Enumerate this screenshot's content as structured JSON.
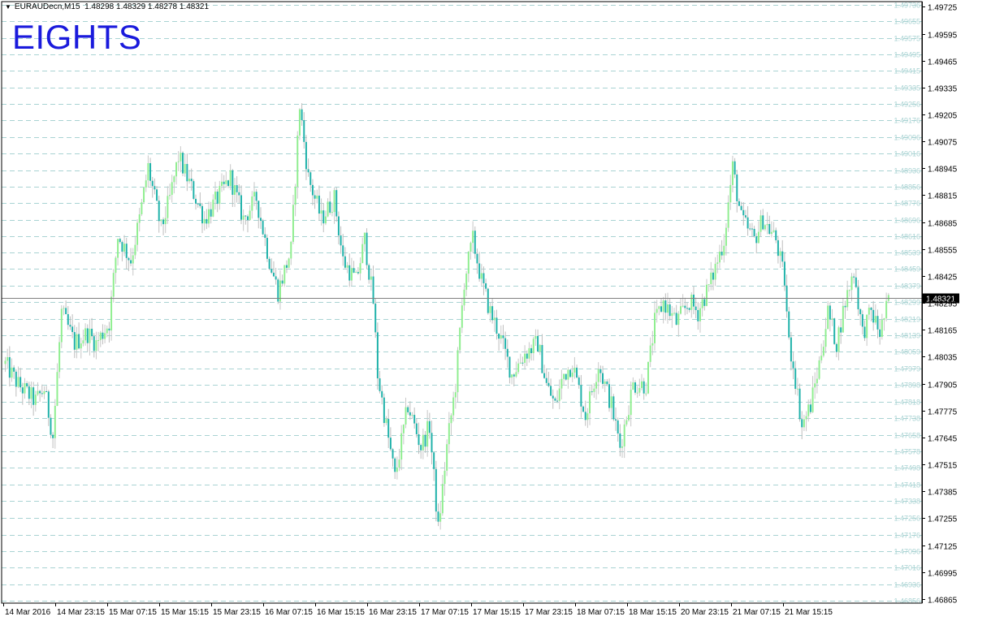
{
  "header": {
    "symbol_period": "EURAUDecn,M15",
    "ohlc": "1.48298 1.48329 1.48278 1.48321"
  },
  "watermark": "EIGHTS",
  "colors": {
    "bull": "#90ee90",
    "bear": "#20b2aa",
    "wick_bull": "#c8c8c8",
    "wick_bear": "#bdbdbd",
    "level": "#a9d3d3",
    "grid": "#d6e6e6",
    "axis": "#000000",
    "price_line": "#808080",
    "price_tag": "#000000"
  },
  "chart_data": {
    "type": "candlestick",
    "title": "",
    "symbol": "EURAUDecn",
    "timeframe": "M15",
    "current_price": "1.48321",
    "ylim": [
      1.46805,
      1.48905
    ],
    "y_ticks": [
      "1.49725",
      "1.49595",
      "1.49465",
      "1.49335",
      "1.49205",
      "1.49075",
      "1.48945",
      "1.48815",
      "1.48685",
      "1.48555",
      "1.48425",
      "1.48295",
      "1.48165",
      "1.48035",
      "1.47905",
      "1.47775",
      "1.47645",
      "1.47515",
      "1.47385",
      "1.47255",
      "1.47125",
      "1.46995",
      "1.46865"
    ],
    "levels": [
      "1.49736",
      "1.49655",
      "1.49575",
      "1.49495",
      "1.49415",
      "1.49335",
      "1.49256",
      "1.49176",
      "1.49096",
      "1.49016",
      "1.48936",
      "1.48856",
      "1.48776",
      "1.48696",
      "1.48616",
      "1.48539",
      "1.48459",
      "1.48379",
      "1.48299",
      "1.48219",
      "1.48139",
      "1.48059",
      "1.47979",
      "1.47898",
      "1.47818",
      "1.47738",
      "1.47658",
      "1.47578",
      "1.47498",
      "1.47418",
      "1.47338",
      "1.47256",
      "1.47176",
      "1.47096",
      "1.47016",
      "1.46936",
      "1.46856"
    ],
    "x_labels": [
      "14 Mar 2016",
      "14 Mar 23:15",
      "15 Mar 07:15",
      "15 Mar 15:15",
      "15 Mar 23:15",
      "16 Mar 07:15",
      "16 Mar 15:15",
      "16 Mar 23:15",
      "17 Mar 07:15",
      "17 Mar 15:15",
      "17 Mar 23:15",
      "18 Mar 07:15",
      "18 Mar 15:15",
      "20 Mar 23:15",
      "21 Mar 07:15",
      "21 Mar 15:15"
    ],
    "waypoints": [
      [
        0,
        1.48
      ],
      [
        6,
        1.479
      ],
      [
        14,
        1.4782
      ],
      [
        18,
        1.4788
      ],
      [
        22,
        1.4765
      ],
      [
        26,
        1.4825
      ],
      [
        32,
        1.481
      ],
      [
        38,
        1.4815
      ],
      [
        42,
        1.481
      ],
      [
        48,
        1.482
      ],
      [
        52,
        1.4862
      ],
      [
        58,
        1.485
      ],
      [
        62,
        1.487
      ],
      [
        66,
        1.4895
      ],
      [
        72,
        1.4865
      ],
      [
        76,
        1.488
      ],
      [
        80,
        1.49
      ],
      [
        86,
        1.4885
      ],
      [
        92,
        1.487
      ],
      [
        98,
        1.488
      ],
      [
        104,
        1.489
      ],
      [
        110,
        1.487
      ],
      [
        116,
        1.488
      ],
      [
        122,
        1.485
      ],
      [
        126,
        1.4835
      ],
      [
        132,
        1.4855
      ],
      [
        136,
        1.4925
      ],
      [
        140,
        1.489
      ],
      [
        146,
        1.487
      ],
      [
        152,
        1.488
      ],
      [
        156,
        1.485
      ],
      [
        162,
        1.484
      ],
      [
        166,
        1.486
      ],
      [
        170,
        1.483
      ],
      [
        172,
        1.4795
      ],
      [
        176,
        1.477
      ],
      [
        180,
        1.4745
      ],
      [
        186,
        1.478
      ],
      [
        192,
        1.476
      ],
      [
        196,
        1.477
      ],
      [
        200,
        1.472
      ],
      [
        204,
        1.476
      ],
      [
        208,
        1.479
      ],
      [
        212,
        1.484
      ],
      [
        216,
        1.486
      ],
      [
        220,
        1.484
      ],
      [
        224,
        1.4825
      ],
      [
        228,
        1.4815
      ],
      [
        234,
        1.4795
      ],
      [
        240,
        1.4805
      ],
      [
        246,
        1.481
      ],
      [
        250,
        1.479
      ],
      [
        254,
        1.478
      ],
      [
        258,
        1.4795
      ],
      [
        262,
        1.48
      ],
      [
        268,
        1.4775
      ],
      [
        274,
        1.48
      ],
      [
        280,
        1.478
      ],
      [
        284,
        1.476
      ],
      [
        290,
        1.479
      ],
      [
        296,
        1.479
      ],
      [
        300,
        1.482
      ],
      [
        304,
        1.483
      ],
      [
        310,
        1.482
      ],
      [
        316,
        1.483
      ],
      [
        320,
        1.4825
      ],
      [
        326,
        1.484
      ],
      [
        332,
        1.486
      ],
      [
        336,
        1.4895
      ],
      [
        340,
        1.487
      ],
      [
        346,
        1.486
      ],
      [
        350,
        1.487
      ],
      [
        356,
        1.486
      ],
      [
        360,
        1.484
      ],
      [
        362,
        1.481
      ],
      [
        364,
        1.48
      ],
      [
        368,
        1.477
      ],
      [
        372,
        1.478
      ],
      [
        376,
        1.48
      ],
      [
        380,
        1.4825
      ],
      [
        384,
        1.481
      ],
      [
        388,
        1.483
      ],
      [
        392,
        1.4845
      ],
      [
        396,
        1.4815
      ],
      [
        400,
        1.4825
      ],
      [
        404,
        1.4815
      ],
      [
        408,
        1.483
      ]
    ]
  }
}
